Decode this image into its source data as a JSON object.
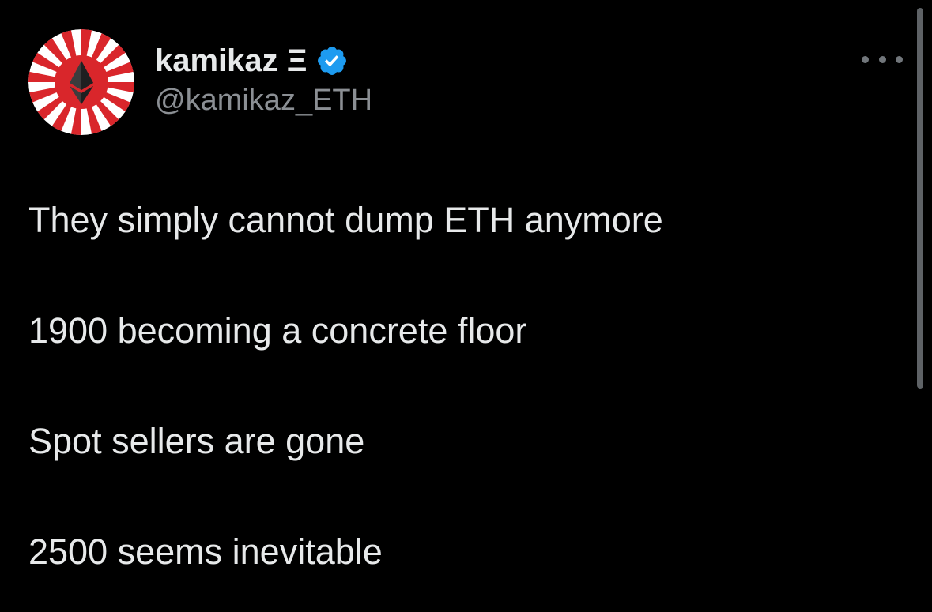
{
  "author": {
    "display_name": "kamikaz Ξ",
    "handle": "@kamikaz_ETH",
    "verified": true,
    "verified_color": "#1d9bf0",
    "avatar_icon": "ethereum-rising-sun-avatar"
  },
  "tweet": {
    "lines": [
      "They simply cannot dump ETH anymore",
      "1900 becoming a concrete floor",
      "Spot sellers are gone",
      "2500 seems inevitable"
    ]
  },
  "icons": {
    "more": "more-options-icon",
    "verified": "verified-badge-icon"
  },
  "colors": {
    "background": "#000000",
    "text": "#e7e9ea",
    "secondary_text": "#8b8f94",
    "avatar_red": "#d9262b",
    "avatar_white": "#ffffff"
  }
}
